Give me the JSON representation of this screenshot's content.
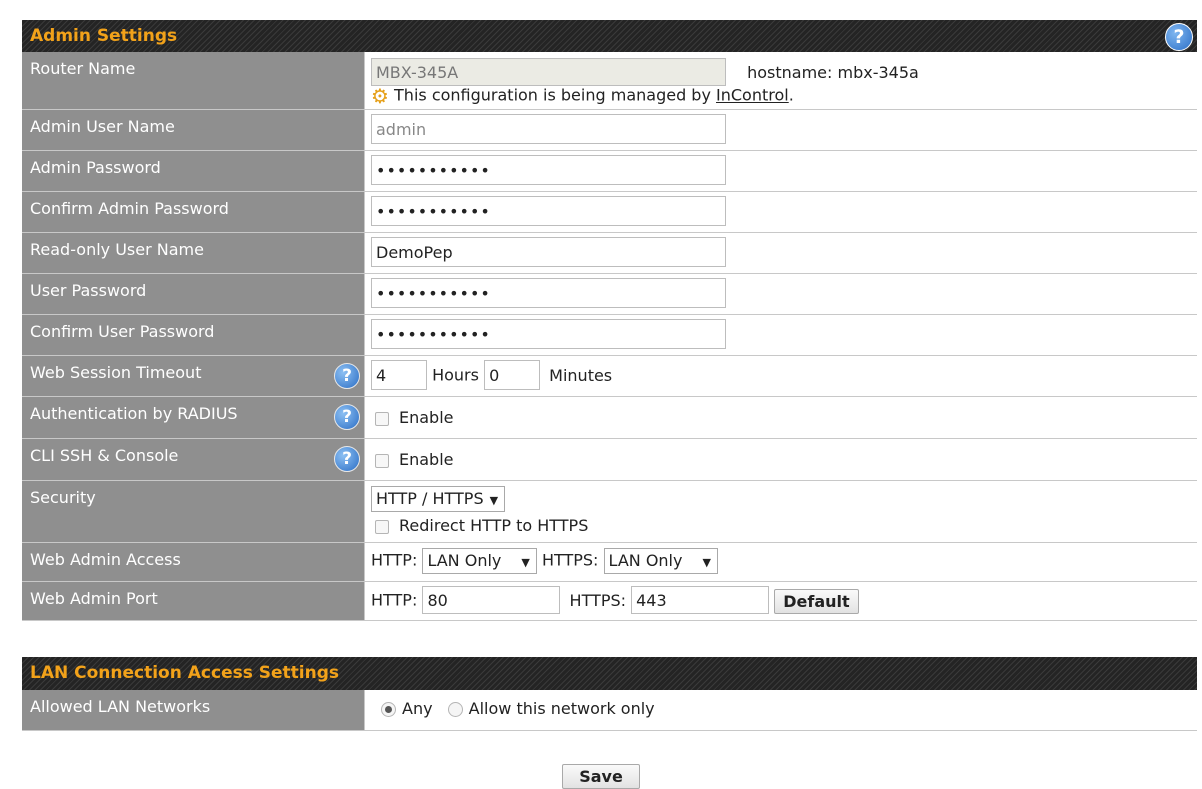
{
  "admin": {
    "title": "Admin Settings",
    "help": "?",
    "router_name": {
      "label": "Router Name",
      "value": "MBX-345A",
      "hostname": "hostname: mbx-345a",
      "managed_prefix": "This configuration is being managed by ",
      "managed_link": "InControl",
      "managed_suffix": "."
    },
    "admin_user": {
      "label": "Admin User Name",
      "value": "admin"
    },
    "admin_password": {
      "label": "Admin Password",
      "value": "•••••••••••"
    },
    "confirm_admin_password": {
      "label": "Confirm Admin Password",
      "value": "•••••••••••"
    },
    "readonly_user": {
      "label": "Read-only User Name",
      "value": "DemoPep"
    },
    "user_password": {
      "label": "User Password",
      "value": "•••••••••••"
    },
    "confirm_user_password": {
      "label": "Confirm User Password",
      "value": "•••••••••••"
    },
    "web_session_timeout": {
      "label": "Web Session Timeout",
      "hours_value": "4",
      "hours_label": "Hours",
      "minutes_value": "0",
      "minutes_label": "Minutes"
    },
    "auth_radius": {
      "label": "Authentication by RADIUS",
      "enable_label": "Enable"
    },
    "cli_ssh": {
      "label": "CLI SSH & Console",
      "enable_label": "Enable"
    },
    "security": {
      "label": "Security",
      "selected": "HTTP / HTTPS",
      "redirect_label": "Redirect HTTP to HTTPS"
    },
    "web_admin_access": {
      "label": "Web Admin Access",
      "http_label": "HTTP:",
      "http_selected": "LAN Only",
      "https_label": "HTTPS:",
      "https_selected": "LAN Only"
    },
    "web_admin_port": {
      "label": "Web Admin Port",
      "http_label": "HTTP:",
      "http_value": "80",
      "https_label": "HTTPS:",
      "https_value": "443",
      "default_button": "Default"
    }
  },
  "lan": {
    "title": "LAN Connection Access Settings",
    "allowed": {
      "label": "Allowed LAN Networks",
      "option_any": "Any",
      "option_network": "Allow this network only"
    }
  },
  "save_button": "Save"
}
